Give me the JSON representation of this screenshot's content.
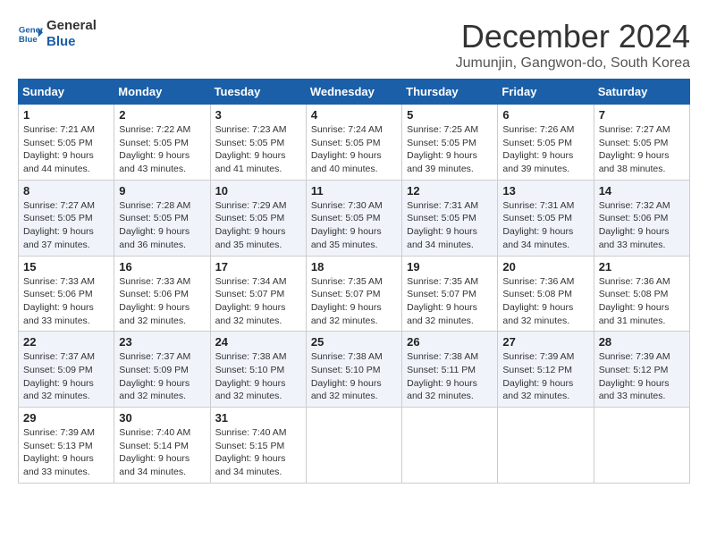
{
  "logo": {
    "line1": "General",
    "line2": "Blue"
  },
  "title": "December 2024",
  "location": "Jumunjin, Gangwon-do, South Korea",
  "days_of_week": [
    "Sunday",
    "Monday",
    "Tuesday",
    "Wednesday",
    "Thursday",
    "Friday",
    "Saturday"
  ],
  "weeks": [
    [
      {
        "day": "1",
        "sunrise": "7:21 AM",
        "sunset": "5:05 PM",
        "daylight": "9 hours and 44 minutes."
      },
      {
        "day": "2",
        "sunrise": "7:22 AM",
        "sunset": "5:05 PM",
        "daylight": "9 hours and 43 minutes."
      },
      {
        "day": "3",
        "sunrise": "7:23 AM",
        "sunset": "5:05 PM",
        "daylight": "9 hours and 41 minutes."
      },
      {
        "day": "4",
        "sunrise": "7:24 AM",
        "sunset": "5:05 PM",
        "daylight": "9 hours and 40 minutes."
      },
      {
        "day": "5",
        "sunrise": "7:25 AM",
        "sunset": "5:05 PM",
        "daylight": "9 hours and 39 minutes."
      },
      {
        "day": "6",
        "sunrise": "7:26 AM",
        "sunset": "5:05 PM",
        "daylight": "9 hours and 39 minutes."
      },
      {
        "day": "7",
        "sunrise": "7:27 AM",
        "sunset": "5:05 PM",
        "daylight": "9 hours and 38 minutes."
      }
    ],
    [
      {
        "day": "8",
        "sunrise": "7:27 AM",
        "sunset": "5:05 PM",
        "daylight": "9 hours and 37 minutes."
      },
      {
        "day": "9",
        "sunrise": "7:28 AM",
        "sunset": "5:05 PM",
        "daylight": "9 hours and 36 minutes."
      },
      {
        "day": "10",
        "sunrise": "7:29 AM",
        "sunset": "5:05 PM",
        "daylight": "9 hours and 35 minutes."
      },
      {
        "day": "11",
        "sunrise": "7:30 AM",
        "sunset": "5:05 PM",
        "daylight": "9 hours and 35 minutes."
      },
      {
        "day": "12",
        "sunrise": "7:31 AM",
        "sunset": "5:05 PM",
        "daylight": "9 hours and 34 minutes."
      },
      {
        "day": "13",
        "sunrise": "7:31 AM",
        "sunset": "5:05 PM",
        "daylight": "9 hours and 34 minutes."
      },
      {
        "day": "14",
        "sunrise": "7:32 AM",
        "sunset": "5:06 PM",
        "daylight": "9 hours and 33 minutes."
      }
    ],
    [
      {
        "day": "15",
        "sunrise": "7:33 AM",
        "sunset": "5:06 PM",
        "daylight": "9 hours and 33 minutes."
      },
      {
        "day": "16",
        "sunrise": "7:33 AM",
        "sunset": "5:06 PM",
        "daylight": "9 hours and 32 minutes."
      },
      {
        "day": "17",
        "sunrise": "7:34 AM",
        "sunset": "5:07 PM",
        "daylight": "9 hours and 32 minutes."
      },
      {
        "day": "18",
        "sunrise": "7:35 AM",
        "sunset": "5:07 PM",
        "daylight": "9 hours and 32 minutes."
      },
      {
        "day": "19",
        "sunrise": "7:35 AM",
        "sunset": "5:07 PM",
        "daylight": "9 hours and 32 minutes."
      },
      {
        "day": "20",
        "sunrise": "7:36 AM",
        "sunset": "5:08 PM",
        "daylight": "9 hours and 32 minutes."
      },
      {
        "day": "21",
        "sunrise": "7:36 AM",
        "sunset": "5:08 PM",
        "daylight": "9 hours and 31 minutes."
      }
    ],
    [
      {
        "day": "22",
        "sunrise": "7:37 AM",
        "sunset": "5:09 PM",
        "daylight": "9 hours and 32 minutes."
      },
      {
        "day": "23",
        "sunrise": "7:37 AM",
        "sunset": "5:09 PM",
        "daylight": "9 hours and 32 minutes."
      },
      {
        "day": "24",
        "sunrise": "7:38 AM",
        "sunset": "5:10 PM",
        "daylight": "9 hours and 32 minutes."
      },
      {
        "day": "25",
        "sunrise": "7:38 AM",
        "sunset": "5:10 PM",
        "daylight": "9 hours and 32 minutes."
      },
      {
        "day": "26",
        "sunrise": "7:38 AM",
        "sunset": "5:11 PM",
        "daylight": "9 hours and 32 minutes."
      },
      {
        "day": "27",
        "sunrise": "7:39 AM",
        "sunset": "5:12 PM",
        "daylight": "9 hours and 32 minutes."
      },
      {
        "day": "28",
        "sunrise": "7:39 AM",
        "sunset": "5:12 PM",
        "daylight": "9 hours and 33 minutes."
      }
    ],
    [
      {
        "day": "29",
        "sunrise": "7:39 AM",
        "sunset": "5:13 PM",
        "daylight": "9 hours and 33 minutes."
      },
      {
        "day": "30",
        "sunrise": "7:40 AM",
        "sunset": "5:14 PM",
        "daylight": "9 hours and 34 minutes."
      },
      {
        "day": "31",
        "sunrise": "7:40 AM",
        "sunset": "5:15 PM",
        "daylight": "9 hours and 34 minutes."
      },
      null,
      null,
      null,
      null
    ]
  ],
  "labels": {
    "sunrise": "Sunrise:",
    "sunset": "Sunset:",
    "daylight": "Daylight:"
  }
}
